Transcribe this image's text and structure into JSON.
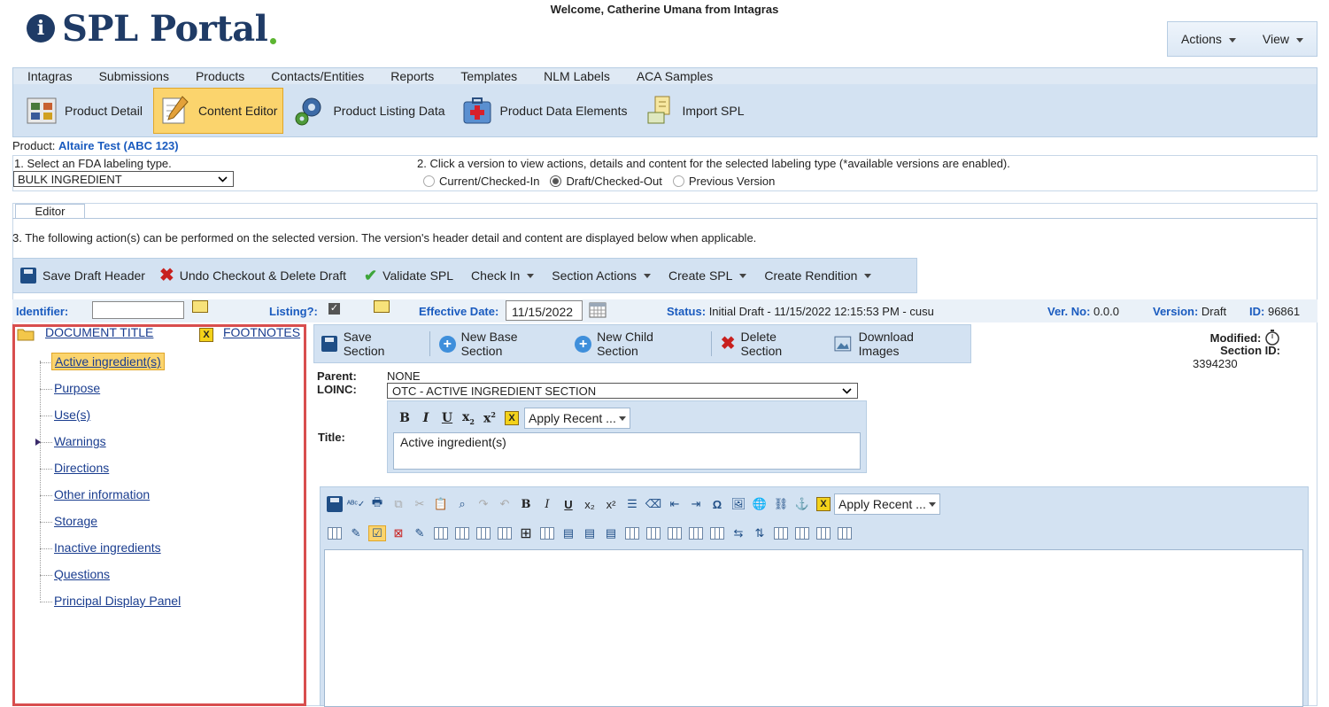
{
  "header": {
    "logo_text": "SPL Portal",
    "welcome": "Welcome, Catherine Umana from Intagras",
    "actions_label": "Actions",
    "view_label": "View"
  },
  "main_nav": [
    "Intagras",
    "Submissions",
    "Products",
    "Contacts/Entities",
    "Reports",
    "Templates",
    "NLM Labels",
    "ACA Samples"
  ],
  "sub_nav": [
    {
      "label": "Product Detail",
      "active": false
    },
    {
      "label": "Content Editor",
      "active": true
    },
    {
      "label": "Product Listing Data",
      "active": false
    },
    {
      "label": "Product Data Elements",
      "active": false
    },
    {
      "label": "Import SPL",
      "active": false
    }
  ],
  "product": {
    "label": "Product:",
    "value": "Altaire Test (ABC 123)"
  },
  "step1": {
    "label": "1. Select an FDA labeling type.",
    "selected": "BULK INGREDIENT"
  },
  "step2": {
    "label": "2. Click a version to view actions, details and content for the selected labeling type (*available versions are enabled).",
    "options": [
      "Current/Checked-In",
      "Draft/Checked-Out",
      "Previous Version"
    ],
    "selected": "Draft/Checked-Out"
  },
  "tabs": {
    "editor": "Editor"
  },
  "step3": "3. The following action(s) can be performed on the selected version. The version's header detail and content are displayed below when applicable.",
  "action_bar": {
    "save_draft_header": "Save Draft Header",
    "undo_checkout": "Undo Checkout & Delete Draft",
    "validate": "Validate SPL",
    "check_in": "Check In",
    "section_actions": "Section Actions",
    "create_spl": "Create SPL",
    "create_rendition": "Create Rendition"
  },
  "info": {
    "identifier_label": "Identifier:",
    "identifier_value": "",
    "listing_label": "Listing?:",
    "effective_label": "Effective Date:",
    "effective_value": "11/15/2022",
    "status_label": "Status:",
    "status_value": "Initial Draft - 11/15/2022 12:15:53 PM - cusu",
    "verno_label": "Ver. No:",
    "verno_value": "0.0.0",
    "version_label": "Version:",
    "version_value": "Draft",
    "id_label": "ID:",
    "id_value": "96861"
  },
  "tree": {
    "document_title": "DOCUMENT TITLE",
    "footnotes": "FOOTNOTES",
    "items": [
      "Active ingredient(s)",
      "Purpose",
      "Use(s)",
      "Warnings",
      "Directions",
      "Other information",
      "Storage",
      "Inactive ingredients",
      "Questions",
      "Principal Display Panel"
    ],
    "selected": "Active ingredient(s)"
  },
  "section_bar": {
    "save": "Save Section",
    "new_base": "New Base Section",
    "new_child": "New Child Section",
    "delete": "Delete Section",
    "download": "Download Images"
  },
  "section_meta": {
    "modified_label": "Modified:",
    "section_id_label": "Section ID:",
    "section_id_value": "3394230"
  },
  "section_form": {
    "parent_label": "Parent:",
    "parent_value": "NONE",
    "loinc_label": "LOINC:",
    "loinc_value": "OTC - ACTIVE INGREDIENT SECTION",
    "title_label": "Title:",
    "title_value": "Active ingredient(s)",
    "apply_recent": "Apply Recent ..."
  },
  "content_editor": {
    "apply_recent": "Apply Recent ..."
  }
}
